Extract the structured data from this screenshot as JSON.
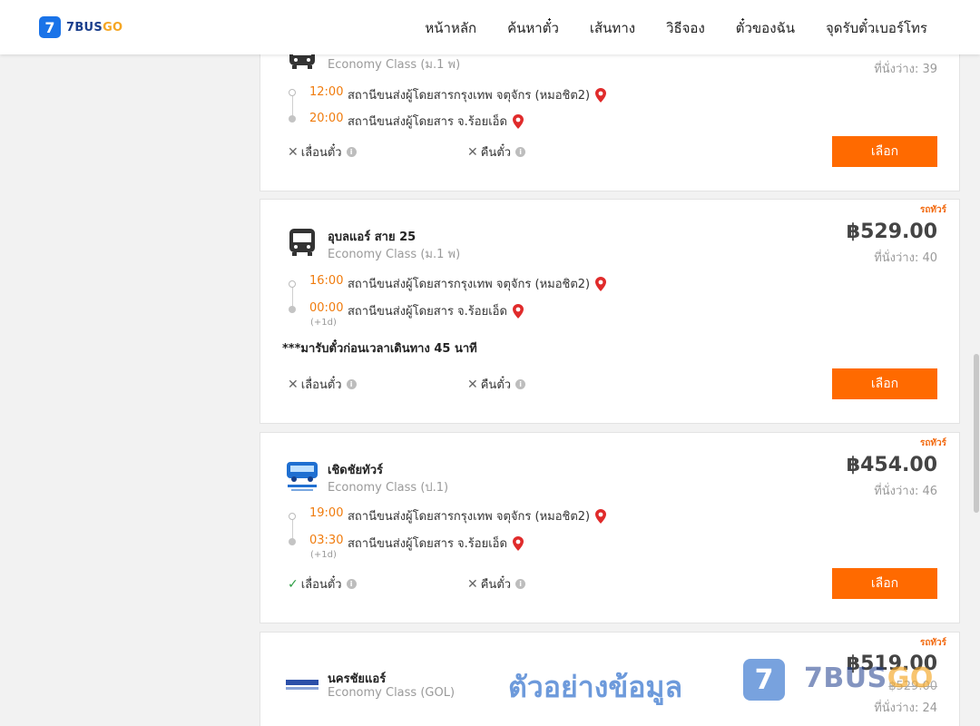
{
  "brand": {
    "badge": "7",
    "name_main": "7BUS",
    "name_accent": "GO"
  },
  "nav": [
    "หน้าหลัก",
    "ค้นหาตั๋ว",
    "เส้นทาง",
    "วิธีจอง",
    "ตั๋วของฉัน",
    "จุดรับตั๋วเบอร์โทร"
  ],
  "labels": {
    "reschedule": "เลื่อนตั๋ว",
    "refund": "คืนตั๋ว",
    "select": "เลือก",
    "info": "i",
    "no_mark": "✕",
    "yes_mark": "✓"
  },
  "trips": [
    {
      "class": "Economy Class (ม.1 พ)",
      "seats": "ที่นั่งว่าง: 39",
      "dep_time": "12:00",
      "dep_station": "สถานีขนส่งผู้โดยสารกรุงเทพ จตุจักร (หมอชิต2)",
      "arr_time": "20:00",
      "arr_station": "สถานีขนส่งผู้โดยสาร จ.ร้อยเอ็ด",
      "reschedule": false,
      "refund": false
    },
    {
      "tag": "รถทัวร์",
      "operator": "อุบลแอร์ สาย 25",
      "class": "Economy Class (ม.1 พ)",
      "price": "฿529.00",
      "seats": "ที่นั่งว่าง: 40",
      "dep_time": "16:00",
      "dep_station": "สถานีขนส่งผู้โดยสารกรุงเทพ จตุจักร (หมอชิต2)",
      "arr_time": "00:00",
      "arr_station": "สถานีขนส่งผู้โดยสาร จ.ร้อยเอ็ด",
      "next_day": "(+1d)",
      "note": "***มารับตั๋วก่อนเวลาเดินทาง 45 นาที",
      "reschedule": false,
      "refund": false
    },
    {
      "tag": "รถทัวร์",
      "operator": "เชิดชัยทัวร์",
      "class": "Economy Class (ป.1)",
      "price": "฿454.00",
      "seats": "ที่นั่งว่าง: 46",
      "dep_time": "19:00",
      "dep_station": "สถานีขนส่งผู้โดยสารกรุงเทพ จตุจักร (หมอชิต2)",
      "arr_time": "03:30",
      "arr_station": "สถานีขนส่งผู้โดยสาร จ.ร้อยเอ็ด",
      "next_day": "(+1d)",
      "reschedule": true,
      "refund": false
    },
    {
      "tag": "รถทัวร์",
      "operator": "นครชัยแอร์",
      "class": "Economy Class (GOL)",
      "price": "฿519.00",
      "old_price": "฿529.00",
      "seats": "ที่นั่งว่าง: 24"
    }
  ],
  "watermark": {
    "text": "ตัวอย่างข้อมูล",
    "badge": "7",
    "brand_main": "7BUS",
    "brand_accent": "GO"
  },
  "colors": {
    "accent": "#ff6a00",
    "time": "#f07c0e",
    "brand_blue": "#1a73e8",
    "pin": "#e02b2b"
  }
}
